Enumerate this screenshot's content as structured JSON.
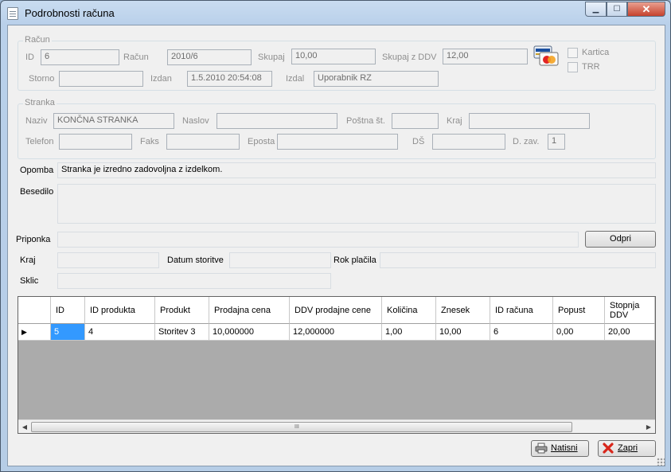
{
  "window": {
    "title": "Podrobnosti računa",
    "min": "▁",
    "max": "☐",
    "close": "✕"
  },
  "racun": {
    "group_title": "Račun",
    "id_label": "ID",
    "id_value": "6",
    "racun_label": "Račun",
    "racun_value": "2010/6",
    "skupaj_label": "Skupaj",
    "skupaj_value": "10,00",
    "skupaj_ddv_label": "Skupaj z DDV",
    "skupaj_ddv_value": "12,00",
    "kartica_label": "Kartica",
    "trr_label": "TRR",
    "storno_label": "Storno",
    "storno_value": "",
    "izdan_label": "Izdan",
    "izdan_value": "1.5.2010 20:54:08",
    "izdal_label": "Izdal",
    "izdal_value": "Uporabnik RZ",
    "card_icon": "credit-card-icon"
  },
  "stranka": {
    "group_title": "Stranka",
    "naziv_label": "Naziv",
    "naziv_value": "KONČNA STRANKA",
    "naslov_label": "Naslov",
    "naslov_value": "",
    "postna_label": "Poštna št.",
    "postna_value": "",
    "kraj_label": "Kraj",
    "kraj_value": "",
    "telefon_label": "Telefon",
    "telefon_value": "",
    "faks_label": "Faks",
    "faks_value": "",
    "eposta_label": "Eposta",
    "eposta_value": "",
    "ds_label": "DŠ",
    "ds_value": "",
    "dzav_label": "D. zav.",
    "dzav_value": "1"
  },
  "details": {
    "opomba_label": "Opomba",
    "opomba_value": "Stranka je izredno zadovoljna z izdelkom.",
    "besedilo_label": "Besedilo",
    "besedilo_value": "",
    "priponka_label": "Priponka",
    "priponka_value": "",
    "odpri_button": "Odpri",
    "kraj_label": "Kraj",
    "kraj_value": "",
    "datum_label": "Datum storitve",
    "datum_value": "",
    "rok_label": "Rok plačila",
    "rok_value": "",
    "sklic_label": "Sklic",
    "sklic_value": ""
  },
  "grid": {
    "columns": [
      "ID",
      "ID produkta",
      "Produkt",
      "Prodajna cena",
      "DDV prodajne cene",
      "Količina",
      "Znesek",
      "ID računa",
      "Popust",
      "Stopnja DDV"
    ],
    "rows": [
      [
        "5",
        "4",
        "Storitev 3",
        "10,000000",
        "12,000000",
        "1,00",
        "10,00",
        "6",
        "0,00",
        "20,00"
      ]
    ],
    "row_marker": "▶",
    "scroll_left": "◀",
    "scroll_right": "▶",
    "scroll_grip": "III"
  },
  "footer": {
    "print_button": "Natisni",
    "close_button": "Zapri"
  }
}
